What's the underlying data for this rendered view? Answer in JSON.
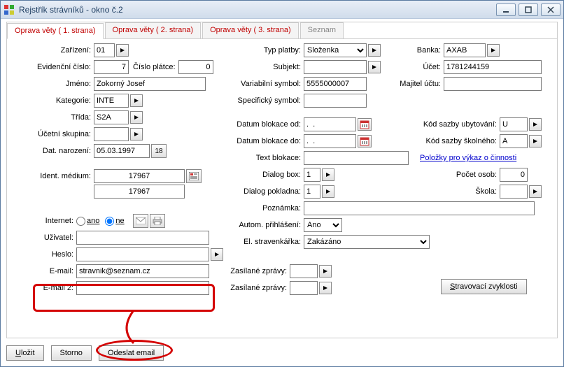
{
  "window": {
    "title": "Rejstřík strávníků - okno č.2"
  },
  "tabs": {
    "t1": "Oprava věty ( 1. strana)",
    "t2": "Oprava věty ( 2. strana)",
    "t3": "Oprava věty ( 3. strana)",
    "t4": "Seznam"
  },
  "labels": {
    "zarizeni": "Zařízení:",
    "evid": "Evidenční číslo:",
    "cisloplatce": "Číslo plátce:",
    "jmeno": "Jméno:",
    "kategorie": "Kategorie:",
    "trida": "Třída:",
    "ucskup": "Účetní skupina:",
    "datnar": "Dat. narození:",
    "ident": "Ident. médium:",
    "internet": "Internet:",
    "uzivatel": "Uživatel:",
    "heslo": "Heslo:",
    "email": "E-mail:",
    "email2": "E-mail 2:",
    "typplatby": "Typ platby:",
    "subjekt": "Subjekt:",
    "varsym": "Variabilní symbol:",
    "specsym": "Specifický symbol:",
    "blokod": "Datum blokace od:",
    "blokdo": "Datum blokace do:",
    "textblok": "Text blokace:",
    "dialogbox": "Dialog box:",
    "dialogpokl": "Dialog pokladna:",
    "poznamka": "Poznámka:",
    "autom": "Autom. přihlášení:",
    "elstrav": "El. stravenkářka:",
    "zaszpr": "Zasílané zprávy:",
    "zaszpr2": "Zasílané zprávy:",
    "banka": "Banka:",
    "ucet": "Účet:",
    "majitel": "Majitel účtu:",
    "kodubyt": "Kód sazby ubytování:",
    "kodskol": "Kód sazby školného:",
    "polozky": "Položky pro výkaz o činnosti",
    "pocetosob": "Počet osob:",
    "skola": "Škola:",
    "ano": "ano",
    "ne": "ne"
  },
  "values": {
    "zarizeni": "01",
    "evid": "7",
    "cisloplatce": "0",
    "jmeno": "Zokorný Josef",
    "kategorie": "INTE",
    "trida": "S2A",
    "ucskup": "",
    "datnar": "05.03.1997",
    "age": "18",
    "ident1": "17967",
    "ident2": "17967",
    "uzivatel": "",
    "heslo": "",
    "email": "stravnik@seznam.cz",
    "email2": "",
    "typplatby": "Složenka",
    "subjekt": "",
    "varsym": "5555000007",
    "specsym": "",
    "blokod": ".  .",
    "blokdo": ".  .",
    "textblok": "",
    "dialogbox": "1",
    "dialogpokl": "1",
    "poznamka": "",
    "autom": "Ano",
    "elstrav": "Zakázáno",
    "zaszpr": "",
    "zaszpr2": "",
    "banka": "AXAB",
    "ucet": "1781244159",
    "majitel": "",
    "kodubyt": "U",
    "kodskol": "A",
    "pocetosob": "0",
    "skola": ""
  },
  "buttons": {
    "ulozit": "Uložit",
    "storno": "Storno",
    "odeslat": "Odeslat email",
    "stravzvy": "Stravovací zvyklosti"
  }
}
